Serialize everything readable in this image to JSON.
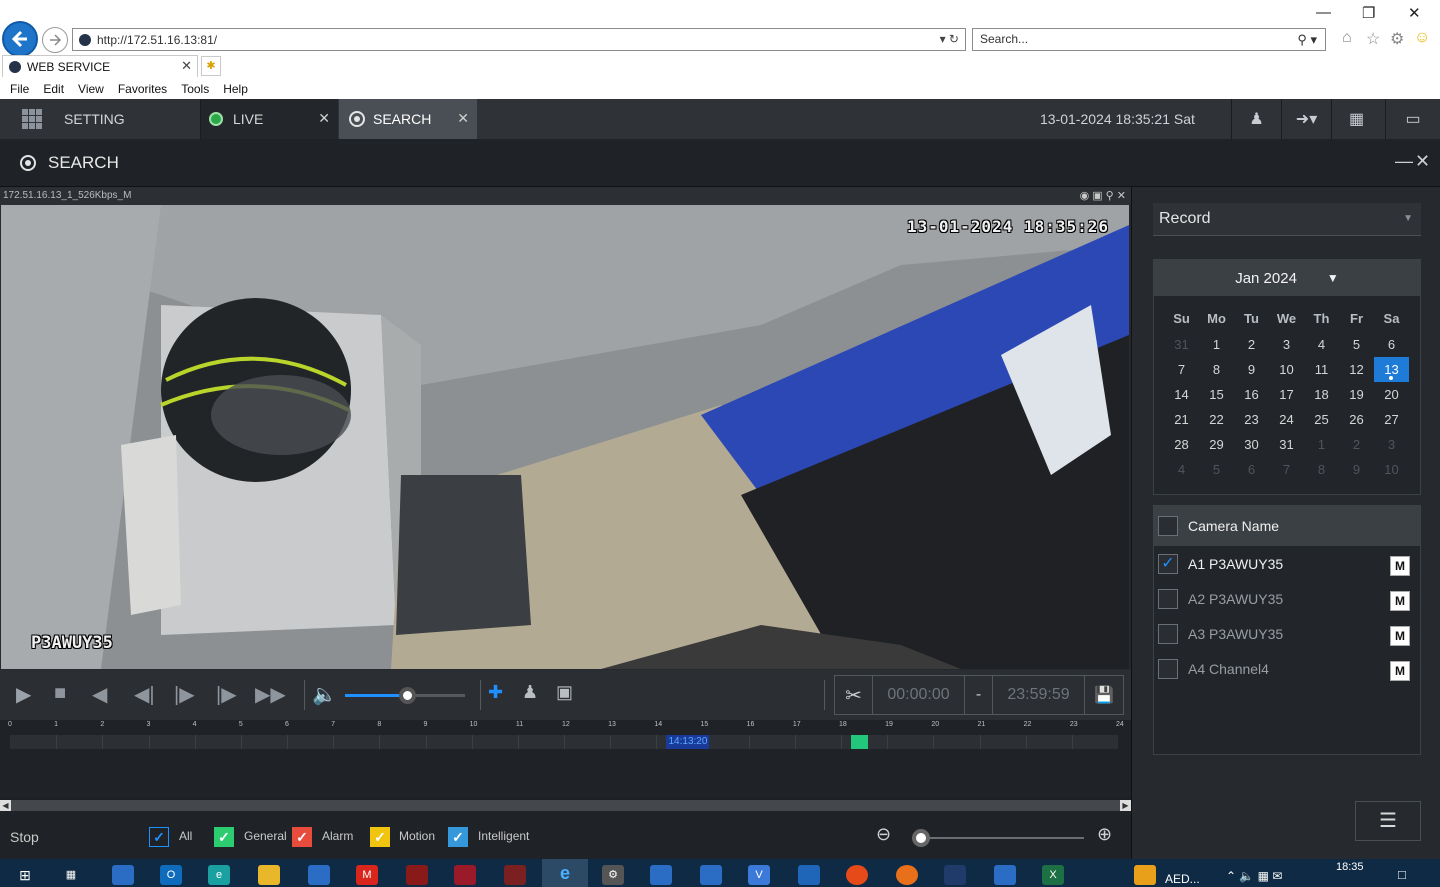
{
  "browser": {
    "url": "http://172.51.16.13:81/",
    "search_placeholder": "Search...",
    "tab_title": "WEB SERVICE",
    "menu": [
      "File",
      "Edit",
      "View",
      "Favorites",
      "Tools",
      "Help"
    ]
  },
  "app": {
    "tabs": {
      "setting": "SETTING",
      "live": "LIVE",
      "search": "SEARCH"
    },
    "datetime": "13-01-2024 18:35:21 Sat",
    "page_title": "SEARCH"
  },
  "video": {
    "stream_label": "172.51.16.13_1_526Kbps_M",
    "osd_time": "13-01-2024 18:35:26",
    "osd_camera": "P3AWUY35"
  },
  "clip": {
    "start": "00:00:00",
    "separator": "-",
    "end": "23:59:59"
  },
  "playback": {
    "volume_fraction": 0.52
  },
  "timeline": {
    "hours": [
      "0",
      "1",
      "2",
      "3",
      "4",
      "5",
      "6",
      "7",
      "8",
      "9",
      "10",
      "11",
      "12",
      "13",
      "14",
      "15",
      "16",
      "17",
      "18",
      "19",
      "20",
      "21",
      "22",
      "23",
      "24"
    ],
    "cursor_label": "14:13:20",
    "cursor_hour": 14.22,
    "records": [
      {
        "start_hour": 18.22,
        "end_hour": 18.58
      }
    ]
  },
  "legend": {
    "state": "Stop",
    "items": [
      {
        "label": "All",
        "color": "#1e90ff",
        "checked": true
      },
      {
        "label": "General",
        "color": "#2ecc71",
        "checked": true
      },
      {
        "label": "Alarm",
        "color": "#e74c3c",
        "checked": true
      },
      {
        "label": "Motion",
        "color": "#f1c40f",
        "checked": true
      },
      {
        "label": "Intelligent",
        "color": "#3498db",
        "checked": true
      }
    ]
  },
  "record_type": "Record",
  "calendar": {
    "month_label": "Jan 2024",
    "weekdays": [
      "Su",
      "Mo",
      "Tu",
      "We",
      "Th",
      "Fr",
      "Sa"
    ],
    "weeks": [
      [
        "31",
        "1",
        "2",
        "3",
        "4",
        "5",
        "6"
      ],
      [
        "7",
        "8",
        "9",
        "10",
        "11",
        "12",
        "13"
      ],
      [
        "14",
        "15",
        "16",
        "17",
        "18",
        "19",
        "20"
      ],
      [
        "21",
        "22",
        "23",
        "24",
        "25",
        "26",
        "27"
      ],
      [
        "28",
        "29",
        "30",
        "31",
        "1",
        "2",
        "3"
      ],
      [
        "4",
        "5",
        "6",
        "7",
        "8",
        "9",
        "10"
      ]
    ],
    "selected_day": "13"
  },
  "cameras": {
    "header": "Camera Name",
    "mode_label": "M",
    "items": [
      {
        "name": "A1 P3AWUY35",
        "checked": true
      },
      {
        "name": "A2 P3AWUY35",
        "checked": false
      },
      {
        "name": "A3 P3AWUY35",
        "checked": false
      },
      {
        "name": "A4 Channel4",
        "checked": false
      }
    ]
  },
  "taskbar": {
    "time": "18:35",
    "app_label": "AED..."
  },
  "colors": {
    "accent": "#1e7bd8",
    "record_green": "#22c77b"
  }
}
